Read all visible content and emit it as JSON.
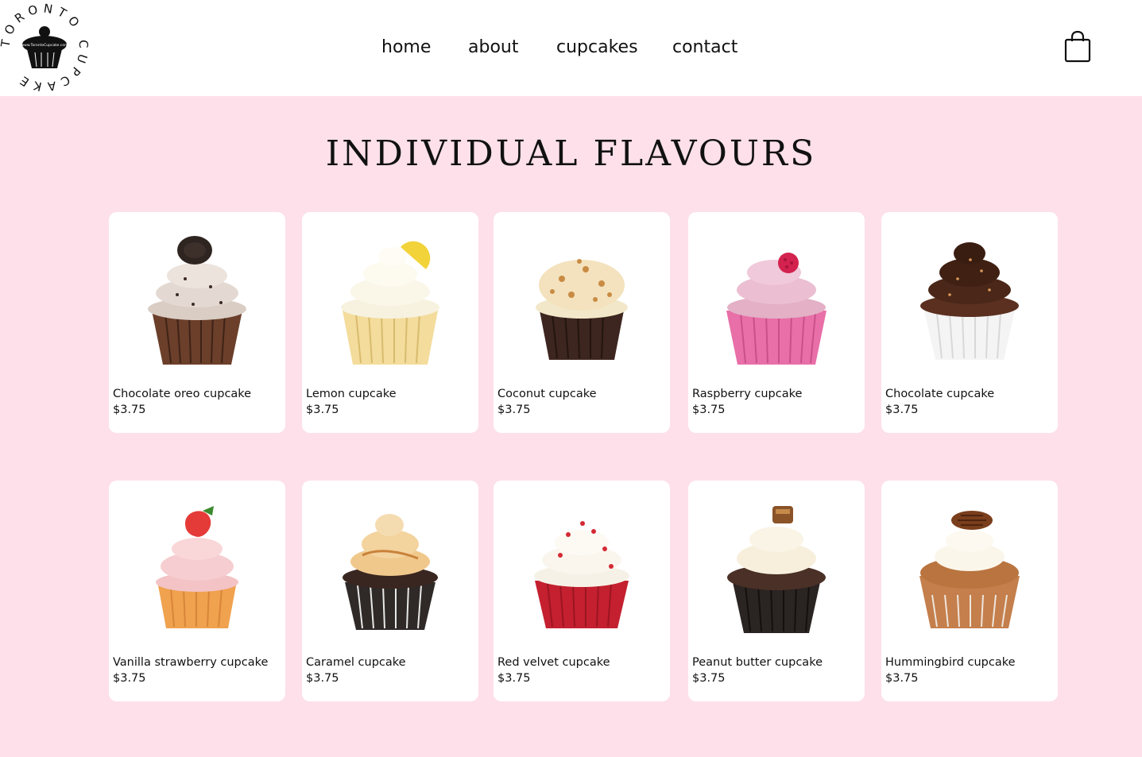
{
  "logo": {
    "ring_text": "TORONTO CUPCAKE",
    "url_text": "www.TorontoCupcake.com"
  },
  "nav": {
    "home": "home",
    "about": "about",
    "cupcakes": "cupcakes",
    "contact": "contact"
  },
  "cart_icon": "shopping-bag-icon",
  "title": "INDIVIDUAL FLAVOURS",
  "colors": {
    "page_background": "#fde0ea",
    "header_background": "#ffffff",
    "card_background": "#ffffff"
  },
  "products": [
    {
      "name": "Chocolate oreo cupcake",
      "price": "$3.75"
    },
    {
      "name": "Lemon cupcake",
      "price": "$3.75"
    },
    {
      "name": "Coconut cupcake",
      "price": "$3.75"
    },
    {
      "name": "Raspberry cupcake",
      "price": "$3.75"
    },
    {
      "name": "Chocolate cupcake",
      "price": "$3.75"
    },
    {
      "name": "Vanilla strawberry cupcake",
      "price": "$3.75"
    },
    {
      "name": "Caramel cupcake",
      "price": "$3.75"
    },
    {
      "name": "Red velvet cupcake",
      "price": "$3.75"
    },
    {
      "name": "Peanut butter cupcake",
      "price": "$3.75"
    },
    {
      "name": "Hummingbird cupcake",
      "price": "$3.75"
    }
  ]
}
